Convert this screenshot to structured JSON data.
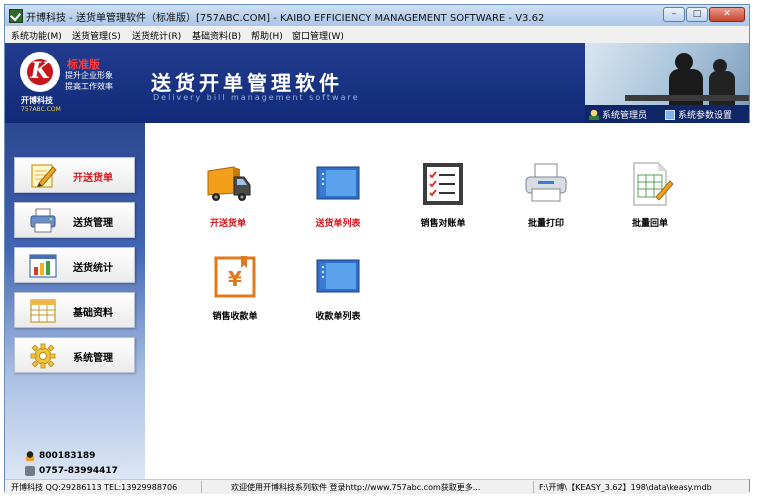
{
  "window": {
    "title": "开博科技 - 送货单管理软件（标准版）[757ABC.COM] - KAIBO EFFICIENCY MANAGEMENT SOFTWARE - V3.62",
    "controls": {
      "minimize": "–",
      "maximize": "□",
      "close": "✕"
    }
  },
  "menu": [
    "系统功能(M)",
    "送货管理(S)",
    "送货统计(R)",
    "基础资料(B)",
    "帮助(H)",
    "窗口管理(W)"
  ],
  "banner": {
    "logo_letter": "K",
    "edition": "标准版",
    "slogan_line1": "提升企业形象",
    "slogan_line2": "提高工作效率",
    "company": "开博科技",
    "company_url": "757ABC.COM",
    "title": "送货开单管理软件",
    "subtitle": "Delivery bill management software",
    "links": [
      {
        "label": "系统管理员",
        "icon": "user-icon"
      },
      {
        "label": "系统参数设置",
        "icon": "monitor-icon"
      }
    ]
  },
  "sidebar": {
    "items": [
      {
        "label": "开送货单",
        "icon": "pencil-note-icon",
        "active": true
      },
      {
        "label": "送货管理",
        "icon": "printer-icon",
        "active": false
      },
      {
        "label": "送货统计",
        "icon": "bar-chart-icon",
        "active": false
      },
      {
        "label": "基础资料",
        "icon": "spreadsheet-icon",
        "active": false
      },
      {
        "label": "系统管理",
        "icon": "gear-icon",
        "active": false
      }
    ],
    "qq": "800183189",
    "phone": "0757-83994417"
  },
  "functions": [
    {
      "label": "开送货单",
      "icon": "truck-icon",
      "highlight": true
    },
    {
      "label": "送货单列表",
      "icon": "list-window-icon",
      "highlight": true
    },
    {
      "label": "销售对账单",
      "icon": "checklist-icon",
      "highlight": false
    },
    {
      "label": "批量打印",
      "icon": "printer-icon",
      "highlight": false
    },
    {
      "label": "批量回单",
      "icon": "document-pen-icon",
      "highlight": false
    },
    {
      "label": "销售收款单",
      "icon": "yen-receipt-icon",
      "highlight": false
    },
    {
      "label": "收款单列表",
      "icon": "list-window-icon",
      "highlight": false
    }
  ],
  "statusbar": {
    "contact": "开博科技 QQ:29286113 TEL:13929988706",
    "welcome": "欢迎使用开博科技系列软件  登录http://www.757abc.com获取更多...",
    "db_path": "F:\\开博\\【KEASY_3.62】198\\data\\keasy.mdb"
  },
  "colors": {
    "banner": "#1a3384",
    "active_label": "#d4141b",
    "edition": "#ff3b3b"
  }
}
